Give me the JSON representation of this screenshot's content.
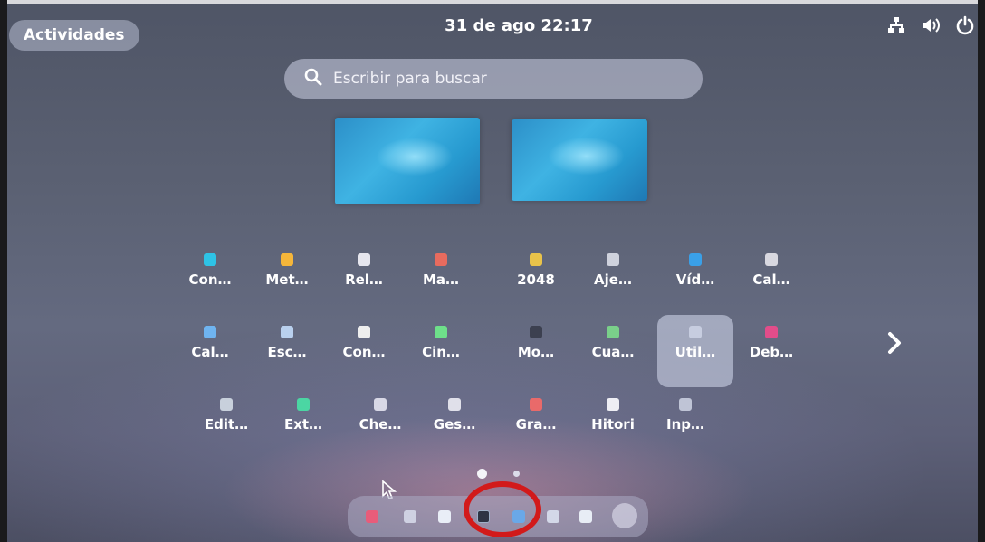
{
  "topbar": {
    "activities_label": "Actividades",
    "datetime": "31 de ago  22:17",
    "tray_icons": [
      "network-icon",
      "volume-icon",
      "power-icon"
    ]
  },
  "search": {
    "placeholder": "Escribir para buscar",
    "icon": "search-icon"
  },
  "workspaces": [
    "workspace-1",
    "workspace-2"
  ],
  "app_grid": {
    "rows": [
      [
        {
          "label": "Con…",
          "color": "#2ec3e6"
        },
        {
          "label": "Met…",
          "color": "#f5b63a"
        },
        {
          "label": "Rel…",
          "color": "#e6e6ee"
        },
        {
          "label": "Ma…",
          "color": "#e86b5e"
        },
        {
          "label": "2048",
          "color": "#e9c34a"
        },
        {
          "label": "Aje…",
          "color": "#cfd2dd"
        },
        {
          "label": "Víd…",
          "color": "#3aa0e8"
        },
        {
          "label": "Cal…",
          "color": "#d8d8e0"
        }
      ],
      [
        {
          "label": "Cal…",
          "color": "#6fb4f0"
        },
        {
          "label": "Esc…",
          "color": "#b9d0ee"
        },
        {
          "label": "Con…",
          "color": "#eeeeee"
        },
        {
          "label": "Cin…",
          "color": "#6ee08a"
        },
        {
          "label": "Mo…",
          "color": "#3c4050"
        },
        {
          "label": "Cua…",
          "color": "#7ad08a"
        },
        {
          "label": "Util…",
          "color": "#c7cde0",
          "selected": true
        },
        {
          "label": "Deb…",
          "color": "#e24d8a"
        }
      ],
      [
        {
          "label": "Edit…",
          "color": "#c8d0dc"
        },
        {
          "label": "Ext…",
          "color": "#4bd6a3"
        },
        {
          "label": "Che…",
          "color": "#d8d8e6"
        },
        {
          "label": "Ges…",
          "color": "#e0e0ea"
        },
        {
          "label": "Gra…",
          "color": "#e96a6a"
        },
        {
          "label": "Hitori",
          "color": "#eeeef4"
        },
        {
          "label": "Inp…",
          "color": "#bfc4d6"
        }
      ]
    ],
    "next_page_icon": "chevron-right-icon"
  },
  "page_indicator": {
    "current": 1,
    "total": 2
  },
  "dash": {
    "items": [
      {
        "name": "dash-item-firefox",
        "color": "#e85c7a"
      },
      {
        "name": "dash-item-software",
        "color": "#cfd1e2"
      },
      {
        "name": "dash-item-files",
        "color": "#e9eef7"
      },
      {
        "name": "dash-item-terminal",
        "color": "#2e3444"
      },
      {
        "name": "dash-item-text-editor",
        "color": "#6aa8e8"
      },
      {
        "name": "dash-item-camera",
        "color": "#d3d8e8"
      },
      {
        "name": "dash-item-help",
        "color": "#e8edf5"
      }
    ],
    "show_apps_icon": "grid-icon"
  },
  "annotation": {
    "color": "#d21a1a"
  }
}
